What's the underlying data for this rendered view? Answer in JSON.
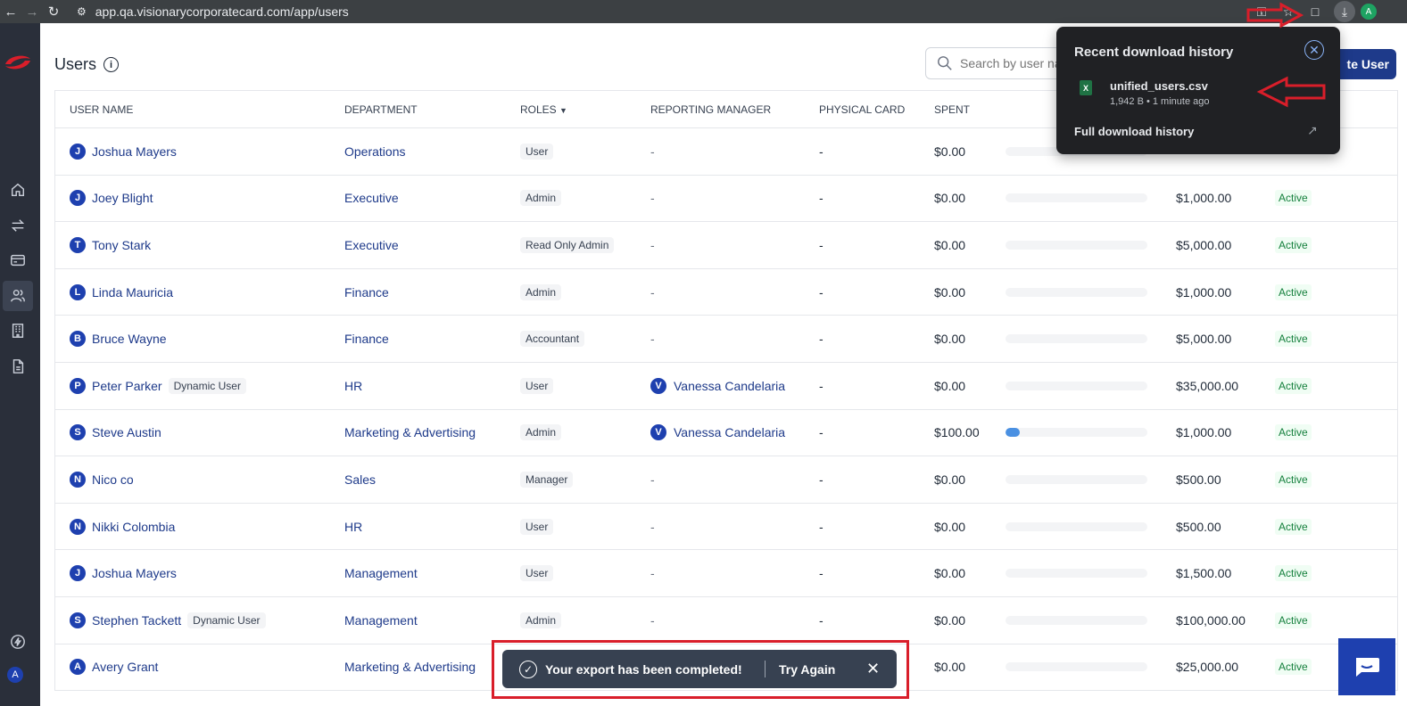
{
  "browser": {
    "url": "app.qa.visionarycorporatecard.com/app/users",
    "profile_initial": "A"
  },
  "sidebar": {
    "user_initial": "A"
  },
  "header": {
    "title": "Users",
    "search_placeholder": "Search by user na",
    "create_label": "te User"
  },
  "table": {
    "columns": [
      "USER NAME",
      "DEPARTMENT",
      "ROLES",
      "REPORTING MANAGER",
      "PHYSICAL CARD",
      "SPENT"
    ],
    "rows": [
      {
        "initial": "J",
        "name": "Joshua Mayers",
        "tag": "",
        "dept": "Operations",
        "role": "User",
        "mgr_initial": "",
        "mgr": "-",
        "card": "-",
        "spent": "$0.00",
        "usage": 0,
        "limit": "",
        "status": ""
      },
      {
        "initial": "J",
        "name": "Joey Blight",
        "tag": "",
        "dept": "Executive",
        "role": "Admin",
        "mgr_initial": "",
        "mgr": "-",
        "card": "-",
        "spent": "$0.00",
        "usage": 0,
        "limit": "$1,000.00",
        "status": "Active"
      },
      {
        "initial": "T",
        "name": "Tony Stark",
        "tag": "",
        "dept": "Executive",
        "role": "Read Only Admin",
        "mgr_initial": "",
        "mgr": "-",
        "card": "-",
        "spent": "$0.00",
        "usage": 0,
        "limit": "$5,000.00",
        "status": "Active"
      },
      {
        "initial": "L",
        "name": "Linda Mauricia",
        "tag": "",
        "dept": "Finance",
        "role": "Admin",
        "mgr_initial": "",
        "mgr": "-",
        "card": "-",
        "spent": "$0.00",
        "usage": 0,
        "limit": "$1,000.00",
        "status": "Active"
      },
      {
        "initial": "B",
        "name": "Bruce Wayne",
        "tag": "",
        "dept": "Finance",
        "role": "Accountant",
        "mgr_initial": "",
        "mgr": "-",
        "card": "-",
        "spent": "$0.00",
        "usage": 0,
        "limit": "$5,000.00",
        "status": "Active"
      },
      {
        "initial": "P",
        "name": "Peter Parker",
        "tag": "Dynamic User",
        "dept": "HR",
        "role": "User",
        "mgr_initial": "V",
        "mgr": "Vanessa Candelaria",
        "card": "-",
        "spent": "$0.00",
        "usage": 0,
        "limit": "$35,000.00",
        "status": "Active"
      },
      {
        "initial": "S",
        "name": "Steve Austin",
        "tag": "",
        "dept": "Marketing & Advertising",
        "role": "Admin",
        "mgr_initial": "V",
        "mgr": "Vanessa Candelaria",
        "card": "-",
        "spent": "$100.00",
        "usage": 0.1,
        "limit": "$1,000.00",
        "status": "Active"
      },
      {
        "initial": "N",
        "name": "Nico co",
        "tag": "",
        "dept": "Sales",
        "role": "Manager",
        "mgr_initial": "",
        "mgr": "-",
        "card": "-",
        "spent": "$0.00",
        "usage": 0,
        "limit": "$500.00",
        "status": "Active"
      },
      {
        "initial": "N",
        "name": "Nikki Colombia",
        "tag": "",
        "dept": "HR",
        "role": "User",
        "mgr_initial": "",
        "mgr": "-",
        "card": "-",
        "spent": "$0.00",
        "usage": 0,
        "limit": "$500.00",
        "status": "Active"
      },
      {
        "initial": "J",
        "name": "Joshua Mayers",
        "tag": "",
        "dept": "Management",
        "role": "User",
        "mgr_initial": "",
        "mgr": "-",
        "card": "-",
        "spent": "$0.00",
        "usage": 0,
        "limit": "$1,500.00",
        "status": "Active"
      },
      {
        "initial": "S",
        "name": "Stephen Tackett",
        "tag": "Dynamic User",
        "dept": "Management",
        "role": "Admin",
        "mgr_initial": "",
        "mgr": "-",
        "card": "-",
        "spent": "$0.00",
        "usage": 0,
        "limit": "$100,000.00",
        "status": "Active"
      },
      {
        "initial": "A",
        "name": "Avery Grant",
        "tag": "",
        "dept": "Marketing & Advertising",
        "role": "",
        "mgr_initial": "",
        "mgr": "",
        "card": "",
        "spent": "$0.00",
        "usage": 0,
        "limit": "$25,000.00",
        "status": "Active"
      }
    ]
  },
  "download_popup": {
    "title": "Recent download history",
    "file_name": "unified_users.csv",
    "file_meta": "1,942 B • 1 minute ago",
    "full_history": "Full download history"
  },
  "toast": {
    "message": "Your export has been completed!",
    "action": "Try Again"
  },
  "colors": {
    "accent": "#1e3a8a",
    "sidebar": "#2a2f3a",
    "annotation": "#d91e2a",
    "active": "#15803d"
  }
}
